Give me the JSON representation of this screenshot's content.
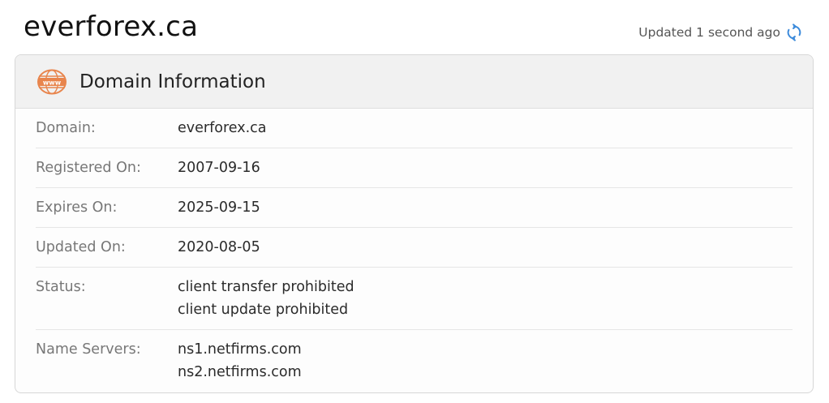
{
  "page": {
    "title": "everforex.ca",
    "updated_text": "Updated 1 second ago",
    "refresh_icon": "refresh-icon"
  },
  "card": {
    "title": "Domain Information",
    "icon": "www-globe-icon",
    "accent_color": "#e8854d",
    "rows": [
      {
        "label": "Domain:",
        "values": [
          "everforex.ca"
        ]
      },
      {
        "label": "Registered On:",
        "values": [
          "2007-09-16"
        ]
      },
      {
        "label": "Expires On:",
        "values": [
          "2025-09-15"
        ]
      },
      {
        "label": "Updated On:",
        "values": [
          "2020-08-05"
        ]
      },
      {
        "label": "Status:",
        "values": [
          "client transfer prohibited",
          "client update prohibited"
        ]
      },
      {
        "label": "Name Servers:",
        "values": [
          "ns1.netfirms.com",
          "ns2.netfirms.com"
        ]
      }
    ]
  }
}
